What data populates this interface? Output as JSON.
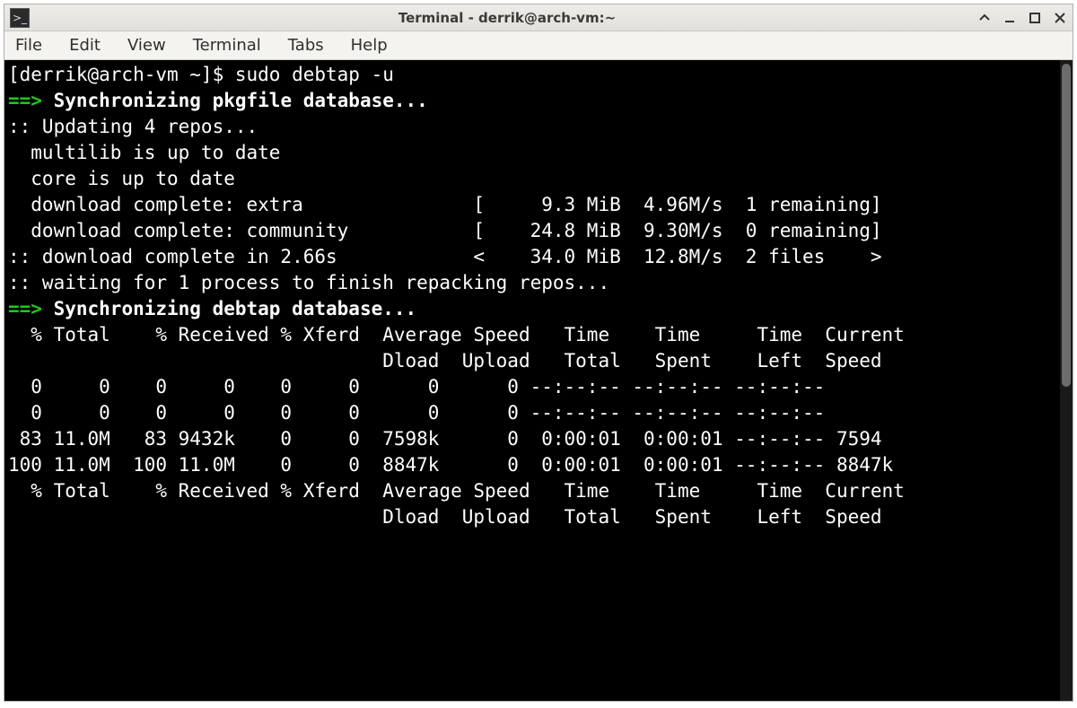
{
  "window": {
    "title": "Terminal - derrik@arch-vm:~"
  },
  "menubar": {
    "items": [
      "File",
      "Edit",
      "View",
      "Terminal",
      "Tabs",
      "Help"
    ]
  },
  "terminal": {
    "prompt": "[derrik@arch-vm ~]$ ",
    "command": "sudo debtap -u",
    "sync_pkgfile_arrow": "==>",
    "sync_pkgfile": " Synchronizing pkgfile database...",
    "updating_repos": ":: Updating 4 repos...",
    "multilib": "  multilib is up to date",
    "core": "  core is up to date",
    "dl_extra": "  download complete: extra               [     9.3 MiB  4.96M/s  1 remaining]",
    "dl_community": "  download complete: community           [    24.8 MiB  9.30M/s  0 remaining]",
    "dl_done": ":: download complete in 2.66s            <    34.0 MiB  12.8M/s  2 files    >",
    "waiting": ":: waiting for 1 process to finish repacking repos...",
    "sync_debtap_arrow": "==>",
    "sync_debtap": " Synchronizing debtap database...",
    "curl_header1": "  % Total    % Received % Xferd  Average Speed   Time    Time     Time  Current",
    "curl_header2": "                                 Dload  Upload   Total   Spent    Left  Speed",
    "curl_row0": "  0     0    0     0    0     0      0      0 --:--:-- --:--:-- --:--:--",
    "curl_row1": "  0     0    0     0    0     0      0      0 --:--:-- --:--:-- --:--:--",
    "curl_row2": " 83 11.0M   83 9432k    0     0  7598k      0  0:00:01  0:00:01 --:--:-- 7594",
    "curl_row3": "100 11.0M  100 11.0M    0     0  8847k      0  0:00:01  0:00:01 --:--:-- 8847k",
    "curl_header3": "  % Total    % Received % Xferd  Average Speed   Time    Time     Time  Current",
    "curl_header4": "                                 Dload  Upload   Total   Spent    Left  Speed"
  }
}
